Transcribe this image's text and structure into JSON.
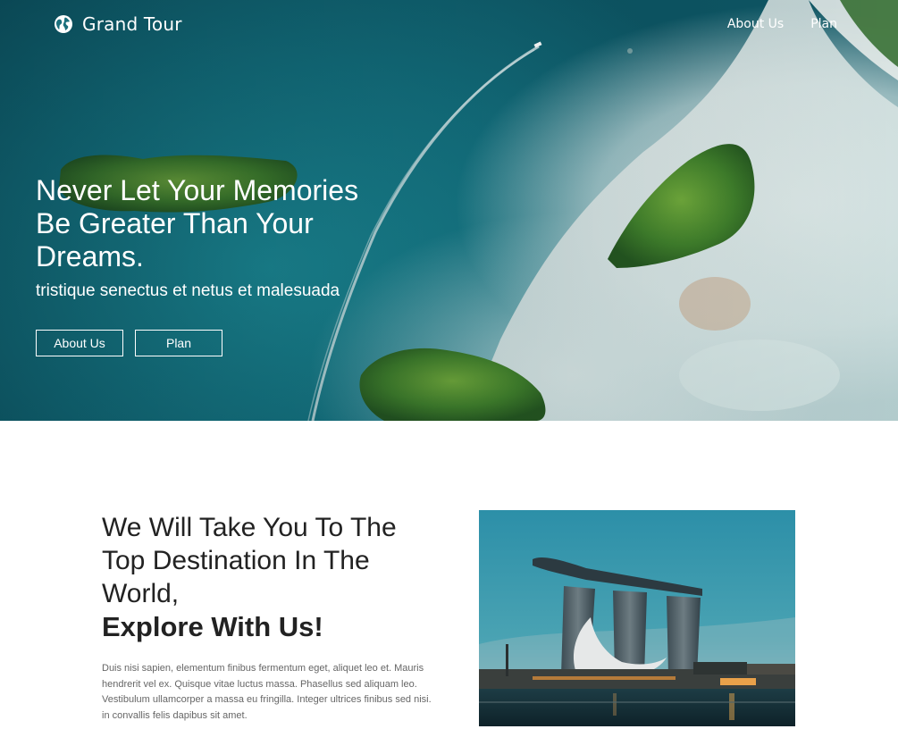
{
  "brand": {
    "name": "Grand Tour",
    "icon": "globe-icon"
  },
  "nav": {
    "items": [
      "About Us",
      "Plan"
    ]
  },
  "hero": {
    "title_lines": [
      "Never Let Your Memories",
      "Be Greater Than Your",
      "Dreams."
    ],
    "subtitle": "tristique senectus et netus et malesuada",
    "buttons": [
      "About Us",
      "Plan"
    ]
  },
  "intro": {
    "heading_lines": [
      "We Will Take You To The",
      "Top Destination In The",
      "World,"
    ],
    "emphasis": "Explore With Us!",
    "body": "Duis nisi sapien, elementum finibus fermentum eget, aliquet leo et. Mauris hendrerit vel ex. Quisque vitae luctus massa. Phasellus sed aliquam leo. Vestibulum ullamcorper a massa eu fringilla. Integer ultrices finibus sed nisi. in convallis felis dapibus sit amet."
  },
  "colors": {
    "accent_white": "#ffffff",
    "text_dark": "#222222",
    "text_muted": "#666666",
    "sea": "#137a87"
  }
}
